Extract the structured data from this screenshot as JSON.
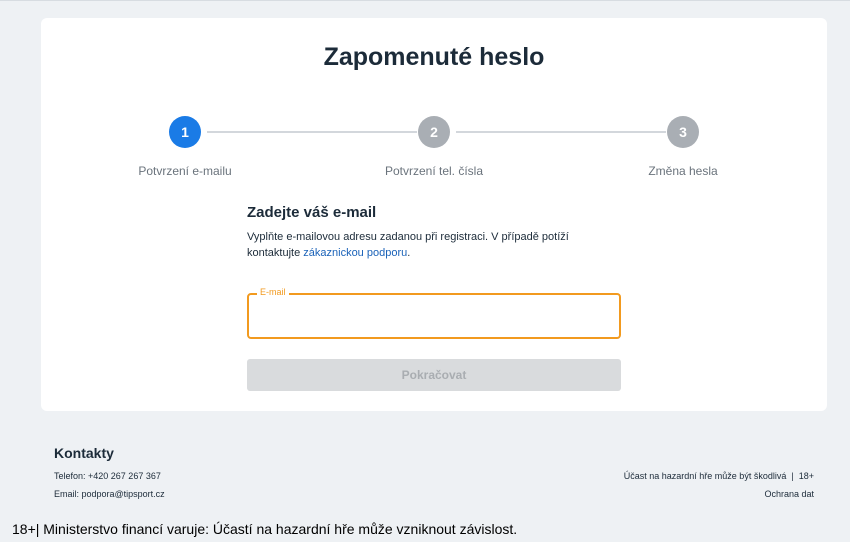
{
  "page": {
    "title": "Zapomenuté heslo"
  },
  "stepper": {
    "steps": [
      {
        "number": "1",
        "label": "Potvrzení e-mailu",
        "state": "active"
      },
      {
        "number": "2",
        "label": "Potvrzení tel. čísla",
        "state": "pending"
      },
      {
        "number": "3",
        "label": "Změna hesla",
        "state": "pending"
      }
    ]
  },
  "form": {
    "heading": "Zadejte váš e-mail",
    "description_prefix": "Vyplňte e-mailovou adresu zadanou při registraci. V případě potíží kontaktujte ",
    "support_link": "zákaznickou podporu",
    "description_suffix": ".",
    "email_label": "E-mail",
    "email_value": "",
    "submit_label": "Pokračovat"
  },
  "footer": {
    "contacts_title": "Kontakty",
    "phone": "Telefon: +420 267 267 367",
    "email": "Email: podpora@tipsport.cz",
    "gambling_notice": "Účast na hazardní hře může být škodlivá",
    "separator": "|",
    "age_limit": "18+",
    "privacy_link": "Ochrana dat"
  },
  "warning_bar": {
    "text": "18+| Ministerstvo financí varuje: Účastí na hazardní hře může vzniknout závislost."
  },
  "colors": {
    "accent": "#1a7be6",
    "field_border": "#f29a1f",
    "disabled_button": "#d9dbdd",
    "background": "#eef1f4"
  }
}
